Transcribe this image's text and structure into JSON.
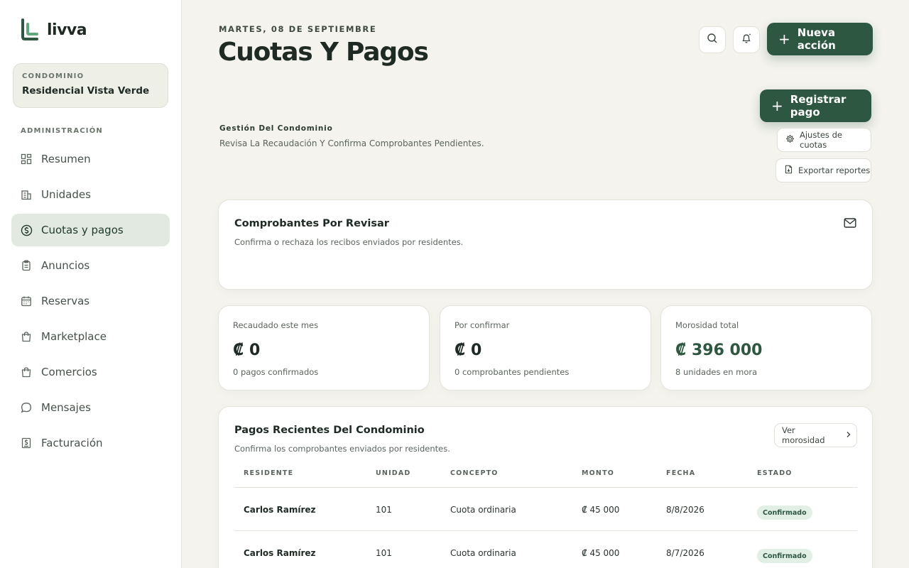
{
  "app": {
    "name": "livva",
    "brand_color": "#2d5740"
  },
  "sidebar": {
    "condo_label": "CONDOMINIO",
    "condo_name": "Residencial Vista Verde",
    "section_label": "ADMINISTRACIÓN",
    "items": [
      {
        "label": "Resumen",
        "icon": "grid-icon",
        "active": false
      },
      {
        "label": "Unidades",
        "icon": "building-icon",
        "active": false
      },
      {
        "label": "Cuotas y pagos",
        "icon": "dollar-circle-icon",
        "active": true
      },
      {
        "label": "Anuncios",
        "icon": "clipboard-icon",
        "active": false
      },
      {
        "label": "Reservas",
        "icon": "calendar-icon",
        "active": false
      },
      {
        "label": "Marketplace",
        "icon": "shopping-bag-icon",
        "active": false
      },
      {
        "label": "Comercios",
        "icon": "store-bag-icon",
        "active": false
      },
      {
        "label": "Mensajes",
        "icon": "chat-bubble-icon",
        "active": false
      },
      {
        "label": "Facturación",
        "icon": "invoice-icon",
        "active": false
      }
    ]
  },
  "header": {
    "date": "MARTES, 08 DE SEPTIEMBRE",
    "title": "Cuotas Y Pagos",
    "new_action_label": "Nueva acción"
  },
  "section": {
    "eyebrow": "Gestión Del Condominio",
    "description": "Revisa La Recaudación Y Confirma Comprobantes Pendientes.",
    "register_label": "Registrar pago",
    "settings_label": "Ajustes de cuotas",
    "export_label": "Exportar reportes"
  },
  "review_card": {
    "title": "Comprobantes Por Revisar",
    "subtitle": "Confirma o rechaza los recibos enviados por residentes."
  },
  "stats": [
    {
      "label": "Recaudado este mes",
      "value": "₡ 0",
      "sub": "0 pagos confirmados"
    },
    {
      "label": "Por confirmar",
      "value": "₡ 0",
      "sub": "0 comprobantes pendientes"
    },
    {
      "label": "Morosidad total",
      "value": "₡ 396 000",
      "sub": "8 unidades en mora"
    }
  ],
  "payments": {
    "title": "Pagos Recientes Del Condominio",
    "subtitle": "Confirma los comprobantes enviados por residentes.",
    "mora_button": "Ver morosidad",
    "columns": [
      "RESIDENTE",
      "UNIDAD",
      "CONCEPTO",
      "MONTO",
      "FECHA",
      "ESTADO"
    ],
    "rows": [
      {
        "resident": "Carlos Ramírez",
        "unit": "101",
        "concept": "Cuota ordinaria",
        "amount": "₡ 45 000",
        "date": "8/8/2026",
        "status": "Confirmado"
      },
      {
        "resident": "Carlos Ramírez",
        "unit": "101",
        "concept": "Cuota ordinaria",
        "amount": "₡ 45 000",
        "date": "8/7/2026",
        "status": "Confirmado"
      }
    ]
  }
}
